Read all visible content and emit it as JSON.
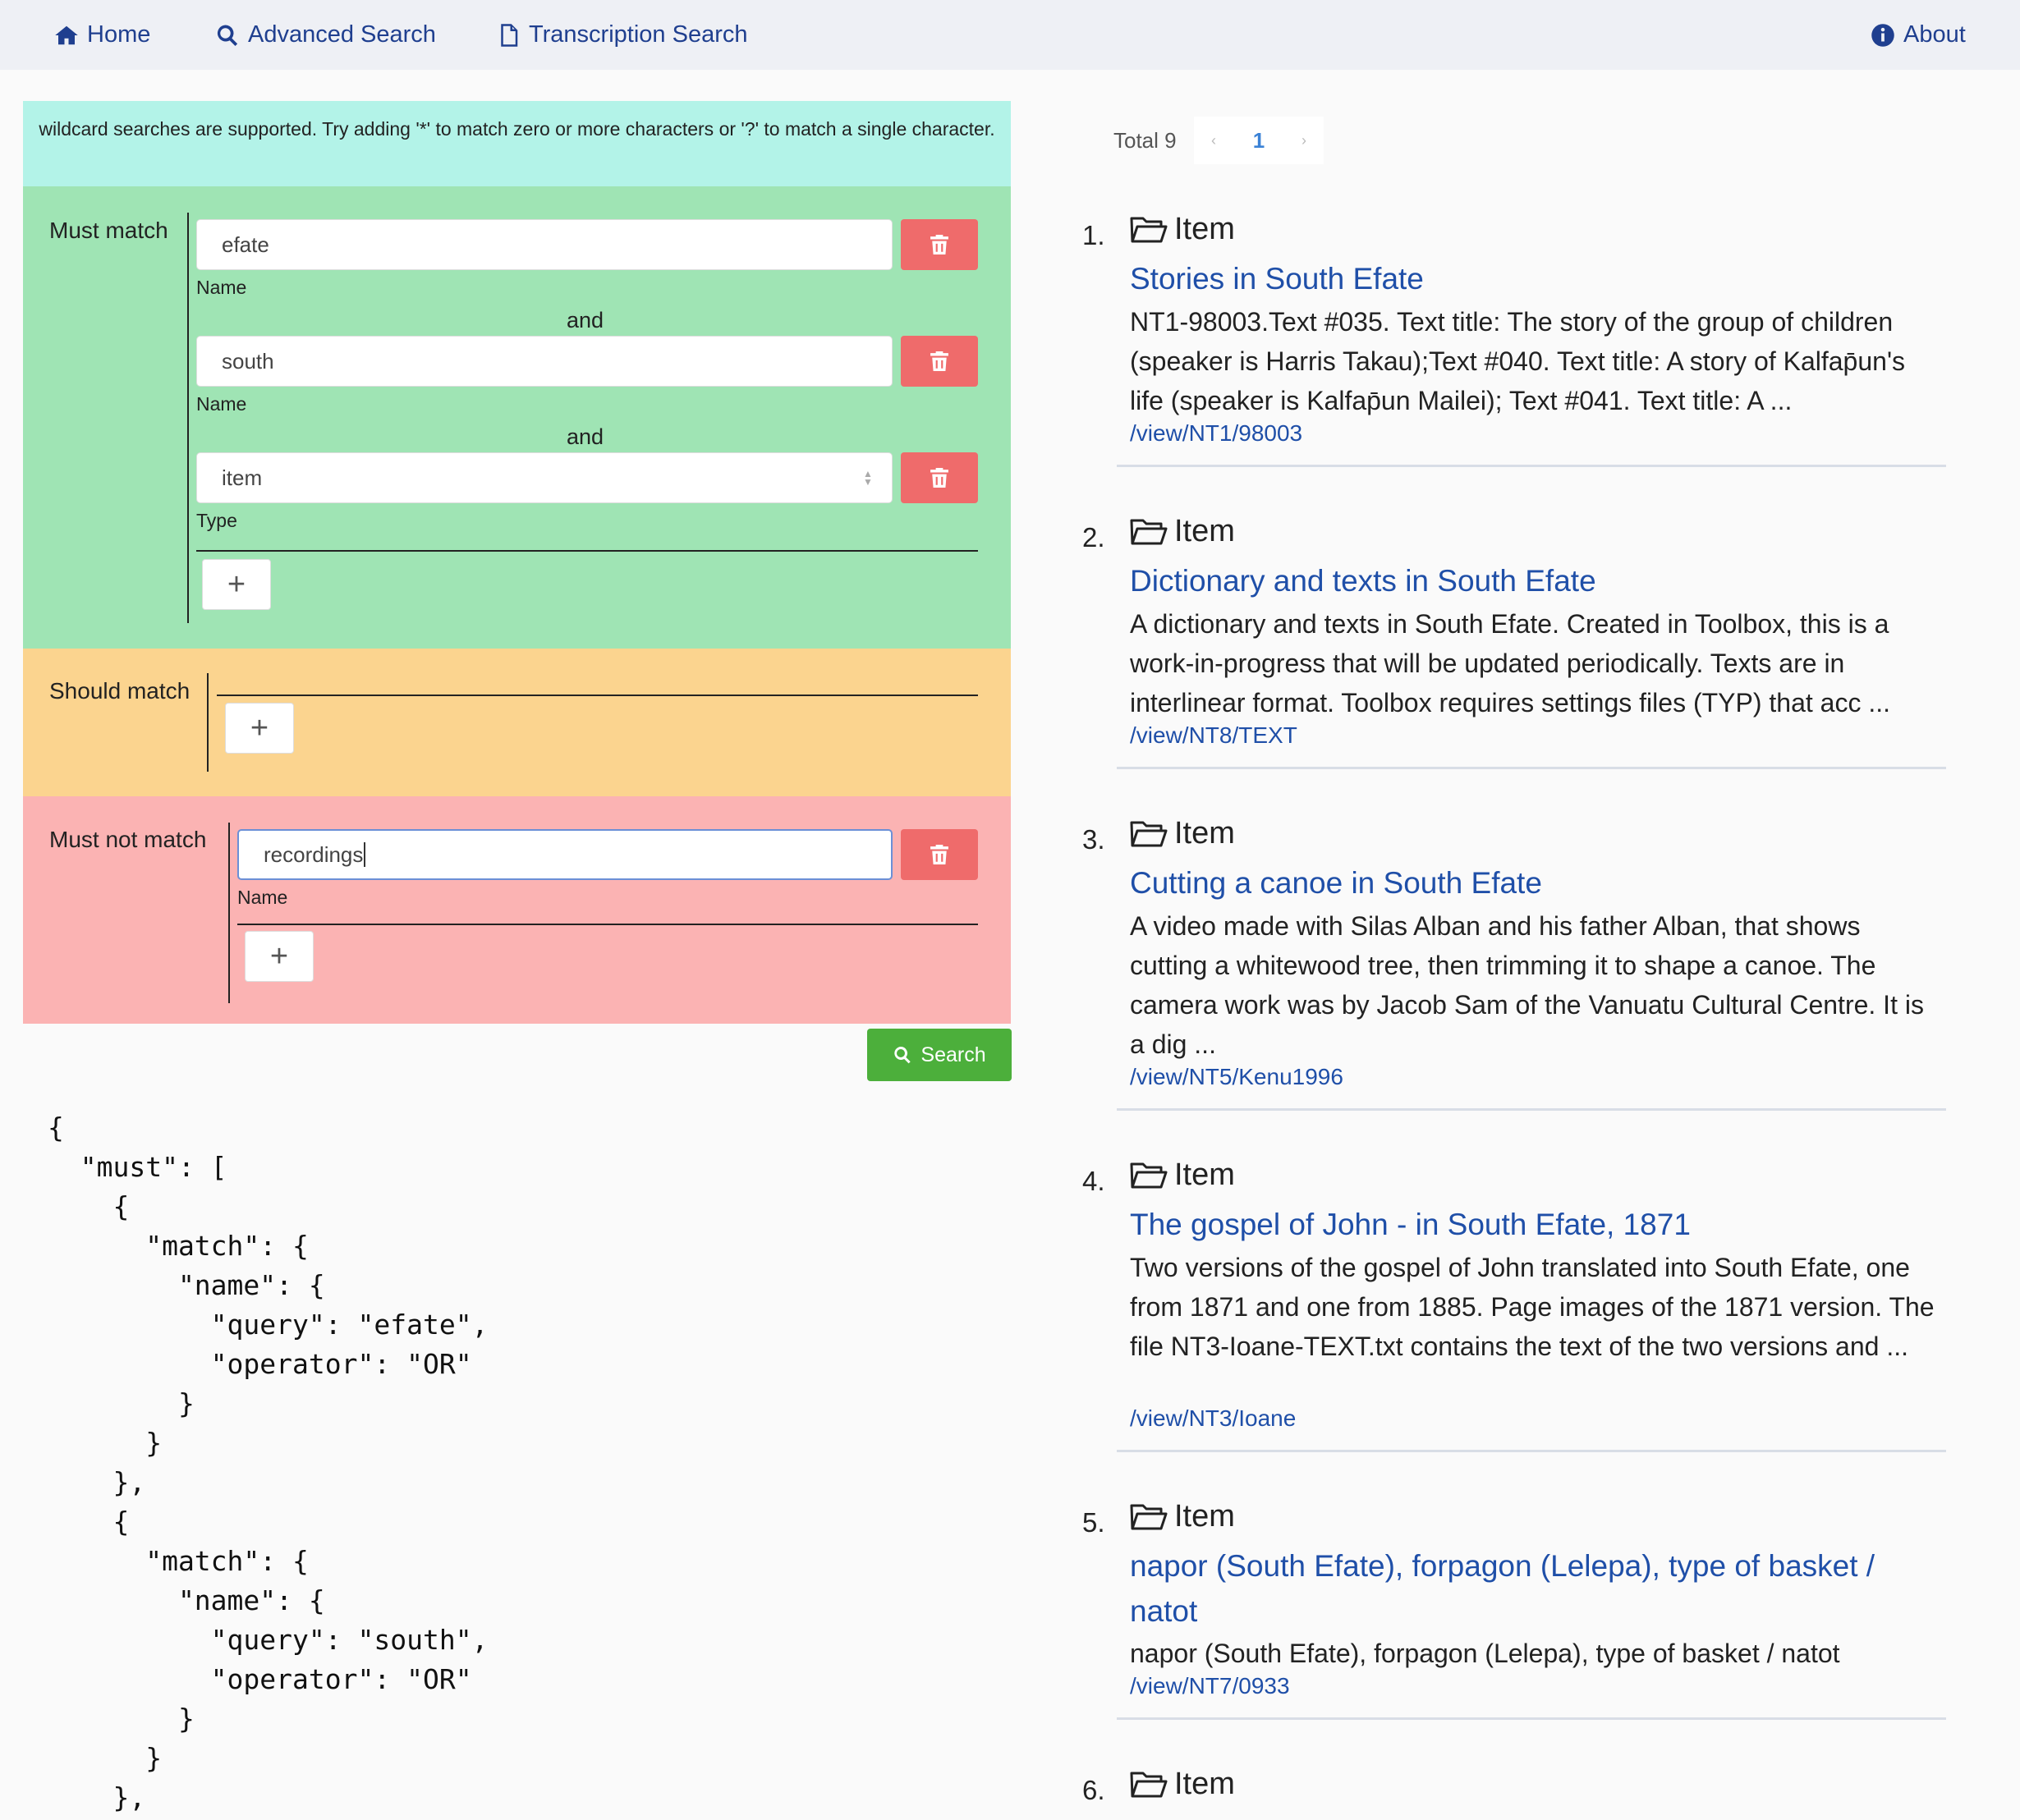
{
  "nav": {
    "home": "Home",
    "advanced_search": "Advanced Search",
    "transcription_search": "Transcription Search",
    "about": "About"
  },
  "search_form": {
    "info": "wildcard searches are supported. Try adding '*' to match zero or more characters or '?' to match a single character.",
    "must_label": "Must match",
    "should_label": "Should match",
    "must_not_label": "Must not match",
    "and_label": "and",
    "must_clauses": [
      {
        "value": "efate",
        "field_label": "Name"
      },
      {
        "value": "south",
        "field_label": "Name"
      },
      {
        "value": "item",
        "field_label": "Type"
      }
    ],
    "must_not_clauses": [
      {
        "value": "recordings",
        "field_label": "Name"
      }
    ],
    "add_symbol": "+",
    "search_button": "Search"
  },
  "query_json": "{\n  \"must\": [\n    {\n      \"match\": {\n        \"name\": {\n          \"query\": \"efate\",\n          \"operator\": \"OR\"\n        }\n      }\n    },\n    {\n      \"match\": {\n        \"name\": {\n          \"query\": \"south\",\n          \"operator\": \"OR\"\n        }\n      }\n    },",
  "pager": {
    "total": "Total 9",
    "current_page": "1"
  },
  "results": [
    {
      "num": "1.",
      "type": "Item",
      "title": "Stories in South Efate",
      "desc": "NT1-98003.Text #035. Text title: The story of the group of children (speaker is Harris Takau);Text #040. Text title: A story of Kalfap̄un's life (speaker is Kalfap̄un Mailei); Text #041. Text title: A ...",
      "link": "/view/NT1/98003"
    },
    {
      "num": "2.",
      "type": "Item",
      "title": "Dictionary and texts in South Efate",
      "desc": "A dictionary and texts in South Efate. Created in Toolbox, this is a work-in-progress that will be updated periodically. Texts are in interlinear format. Toolbox requires settings files (TYP) that acc ...",
      "link": "/view/NT8/TEXT"
    },
    {
      "num": "3.",
      "type": "Item",
      "title": "Cutting a canoe in South Efate",
      "desc": "A video made with Silas Alban and his father Alban, that shows cutting a whitewood tree, then trimming it to shape a canoe. The camera work was by Jacob Sam of the Vanuatu Cultural Centre. It is a dig ...",
      "link": "/view/NT5/Kenu1996"
    },
    {
      "num": "4.",
      "type": "Item",
      "title": "The gospel of John - in South Efate, 1871",
      "desc": "Two versions of the gospel of John translated into South Efate, one from 1871 and one from 1885. Page images of the 1871 version. The file NT3-Ioane-TEXT.txt contains the text of the two versions and ...",
      "link": "/view/NT3/Ioane"
    },
    {
      "num": "5.",
      "type": "Item",
      "title": "napor (South Efate), forpagon (Lelepa), type of basket / natot",
      "desc": "napor (South Efate), forpagon (Lelepa), type of basket / natot",
      "link": "/view/NT7/0933"
    },
    {
      "num": "6.",
      "type": "Item"
    }
  ]
}
